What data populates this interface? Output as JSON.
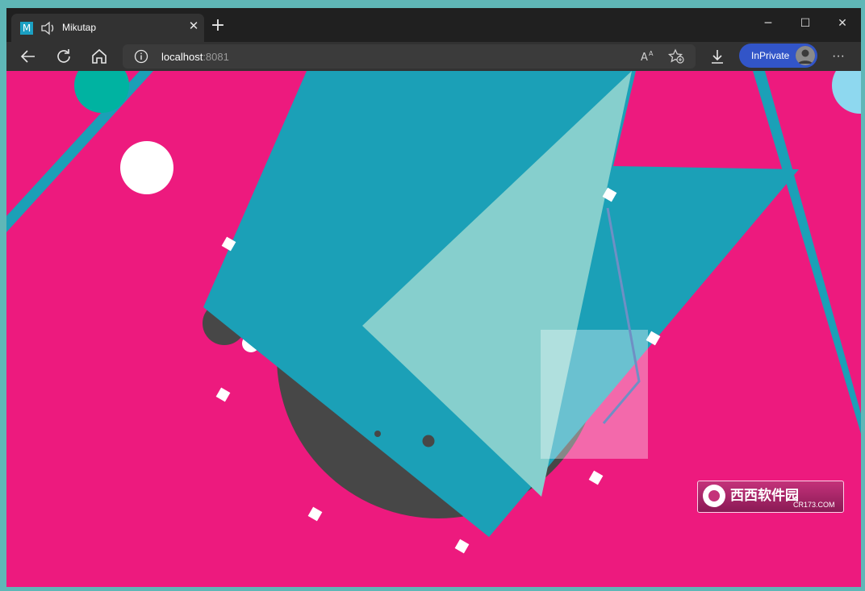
{
  "browser": {
    "tab": {
      "title": "Mikutap",
      "favicon_letter": "M",
      "sound_icon": "speaker-icon",
      "close_icon": "close-icon"
    },
    "new_tab_icon": "plus-icon",
    "window_controls": {
      "minimize": "─",
      "maximize": "☐",
      "close": "✕"
    },
    "nav": {
      "back": "back-arrow-icon",
      "reload": "reload-icon",
      "home": "home-icon"
    },
    "address": {
      "host": "localhost",
      "port": ":8081",
      "info_icon": "info-icon",
      "read_aloud_icon": "read-aloud-icon",
      "favorites_icon": "add-favorite-icon"
    },
    "download_icon": "download-icon",
    "inprivate_label": "InPrivate",
    "more_label": "···"
  },
  "content": {
    "background_color": "#ed1a7e",
    "colors": {
      "teal_dark": "#1ba0b7",
      "teal_light": "#86cfcd",
      "charcoal": "#474747",
      "white": "#ffffff",
      "green": "#00b3a1",
      "sky": "#8ed8ef",
      "pink_light": "#f27cad"
    }
  },
  "watermark": {
    "title": "西西软件园",
    "url": "CR173.COM"
  }
}
